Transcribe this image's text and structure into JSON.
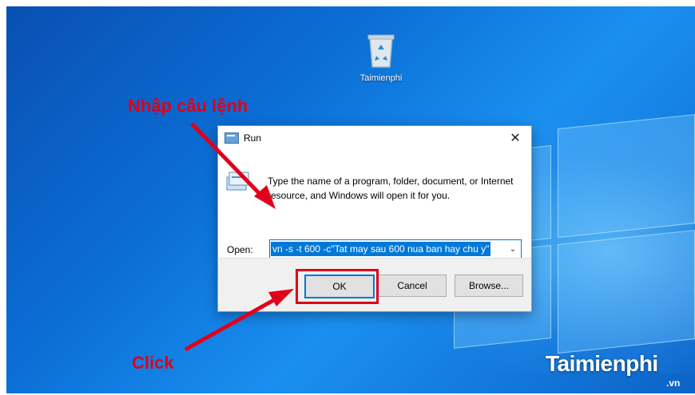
{
  "desktop": {
    "icon_label": "Taimienphi"
  },
  "dialog": {
    "title": "Run",
    "close_glyph": "✕",
    "description": "Type the name of a program, folder, document, or Internet resource, and Windows will open it for you.",
    "open_label": "Open:",
    "open_value": "vn -s -t 600 -c\"Tat may sau 600 nua ban hay chu y\"",
    "dropdown_glyph": "⌄",
    "ok_label": "OK",
    "cancel_label": "Cancel",
    "browse_label": "Browse..."
  },
  "annotations": {
    "top_label": "Nhập câu lệnh",
    "bottom_label": "Click",
    "color": "#e0001b"
  },
  "watermark": {
    "brand": "Taimienphi",
    "suffix": ".vn"
  },
  "icons": [
    "recycle-bin-icon",
    "run-title-icon",
    "run-program-icon",
    "close-icon",
    "dropdown-arrow-icon",
    "arrow-pointer-icon"
  ],
  "colors": {
    "accent": "#0078d7",
    "desktop": "#0b6fd6"
  }
}
